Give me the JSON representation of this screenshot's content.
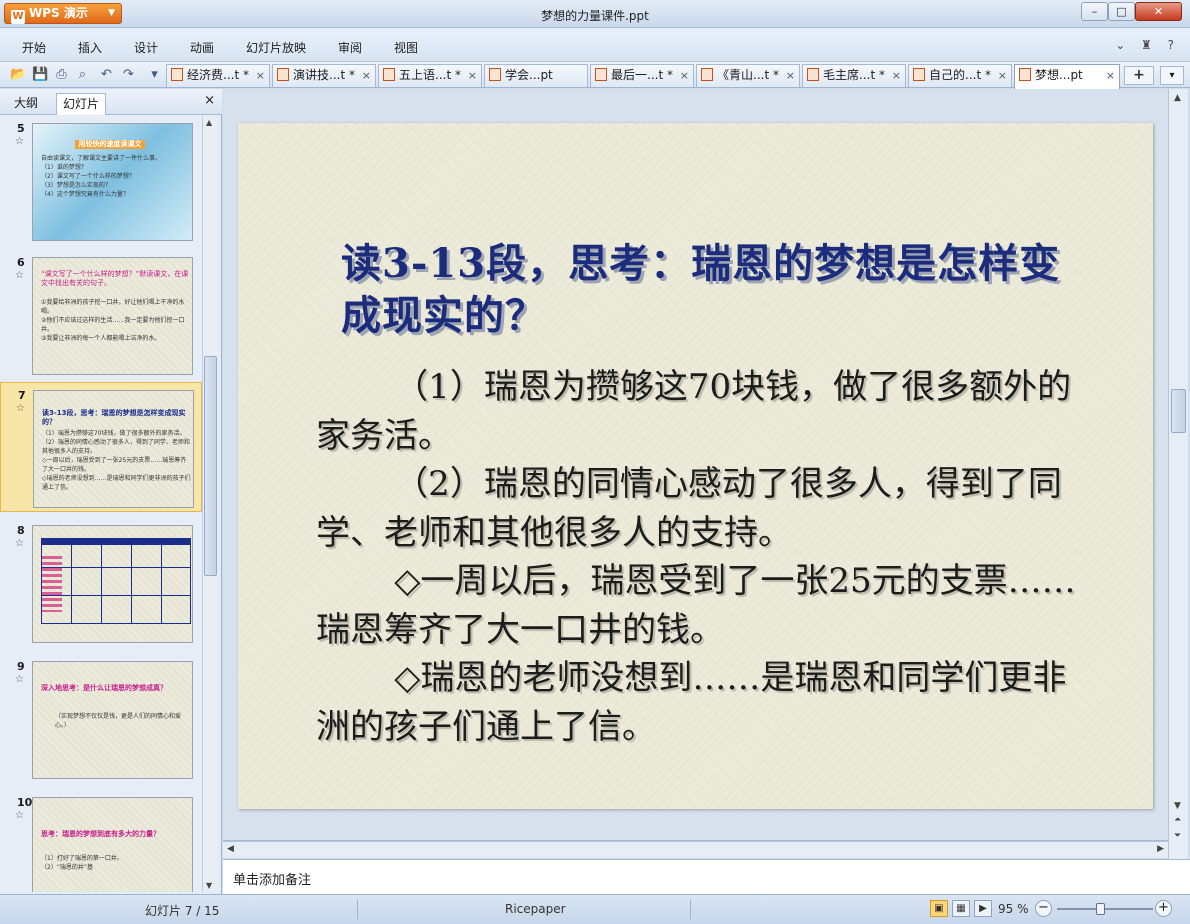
{
  "app": {
    "name": "WPS 演示",
    "logo_glyph": "W"
  },
  "window": {
    "title": "梦想的力量课件.ppt",
    "min": "–",
    "max": "□",
    "close": "✕"
  },
  "menu": {
    "items": [
      "开始",
      "插入",
      "设计",
      "动画",
      "幻灯片放映",
      "审阅",
      "视图"
    ],
    "right_controls": "⌄ ♜ ?"
  },
  "toolbar": {
    "icons": [
      "open-icon",
      "save-icon",
      "print-icon",
      "print-preview-icon",
      "undo-icon",
      "redo-icon",
      "customize-icon"
    ],
    "tabs": [
      {
        "label": "经济费...t *",
        "active": false
      },
      {
        "label": "演讲技...t *",
        "active": false
      },
      {
        "label": "五上语...t *",
        "active": false
      },
      {
        "label": "学会...pt",
        "active": false
      },
      {
        "label": "最后一...t *",
        "active": false
      },
      {
        "label": "《青山...t *",
        "active": false
      },
      {
        "label": "毛主席...t *",
        "active": false
      },
      {
        "label": "自己的...t *",
        "active": false
      },
      {
        "label": "梦想...pt",
        "active": true
      }
    ],
    "tab_close": "×",
    "new_tab": "+",
    "tab_list": "▾"
  },
  "left_panel": {
    "tabs": [
      "大纲",
      "幻灯片"
    ],
    "active_tab": "幻灯片",
    "close": "×",
    "star": "☆",
    "thumbnails": [
      {
        "num": "5",
        "title": "用较快的速度读课文",
        "body": "自由读课文，了解课文主要讲了一件什么事。\n（1）谁的梦想？\n（2）课文写了一个什么样的梦想？\n（3）梦想是怎么实现的？\n（4）这个梦想究竟有什么力量？"
      },
      {
        "num": "6",
        "title": "“课文写了一个什么样的梦想？”默读课文，在课文中找出有关的句子。",
        "body": "①我要给非洲的孩子挖一口井，好让他们喝上干净的水喝。\n②他们不应该过这样的生活……我一定要为他们挖一口井。\n③我要让非洲的每一个人都能喝上洁净的水。"
      },
      {
        "num": "7",
        "title": "读3-13段，思考：瑞恩的梦想是怎样变成现实的？",
        "body": "（1）瑞恩为攒够这70块钱，做了很多额外的家务活。\n（2）瑞恩的同情心感动了很多人，得到了同学、老师和其他很多人的支持。\n◇一周以后，瑞恩受到了一张25元的支票……瑞恩筹齐了大一口井的钱。\n◇瑞恩的老师没想到……是瑞恩和同学们更非洲的孩子们通上了信。"
      },
      {
        "num": "8",
        "title": "",
        "body": ""
      },
      {
        "num": "9",
        "title": "深入地思考：是什么让瑞恩的梦想成真？",
        "body": "（实现梦想不仅仅是钱，更是人们的同情心和爱心。）"
      },
      {
        "num": "10",
        "title": "思考：瑞恩的梦想到底有多大的力量？",
        "body": "（1）打好了瑞恩的第一口井。\n（2）“瑞恩的井”基"
      }
    ]
  },
  "slide": {
    "title": "读3-13段，思考：瑞恩的梦想是怎样变成现实的？",
    "paragraphs": [
      "（1）瑞恩为攒够这70块钱，做了很多额外的家务活。",
      "（2）瑞恩的同情心感动了很多人，得到了同学、老师和其他很多人的支持。",
      "◇一周以后，瑞恩受到了一张25元的支票……瑞恩筹齐了大一口井的钱。",
      "◇瑞恩的老师没想到……是瑞恩和同学们更非洲的孩子们通上了信。"
    ]
  },
  "notes": {
    "placeholder": "单击添加备注"
  },
  "status": {
    "slide_info": "幻灯片 7 / 15",
    "theme": "Ricepaper",
    "zoom": "95 %",
    "zoom_fraction": 0.45,
    "view_buttons": [
      "normal-view-icon",
      "slide-sorter-icon",
      "slideshow-icon"
    ],
    "zoom_out": "−",
    "zoom_in": "+"
  },
  "colors": {
    "title_blue": "#1b2c7c",
    "wps_orange": "#e0691a",
    "selected_thumb": "#f8e6a8"
  }
}
